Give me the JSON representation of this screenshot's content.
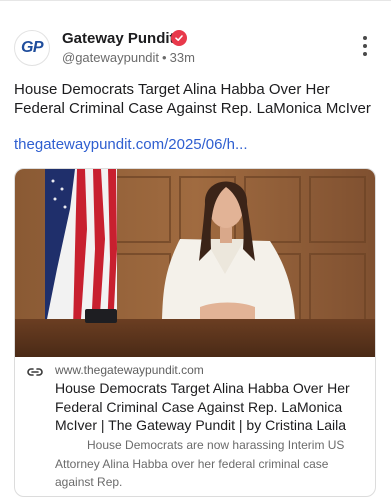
{
  "author": {
    "avatar_text": "GP",
    "name": "Gateway Pundit",
    "handle": "@gatewaypundit",
    "separator": "•",
    "time": "33m"
  },
  "post": {
    "text": "House Democrats Target Alina Habba Over Her Federal Criminal Case Against Rep. LaMonica McIver",
    "link_text": "thegatewaypundit.com/2025/06/h..."
  },
  "card": {
    "domain": "www.thegatewaypundit.com",
    "title": "House Democrats Target Alina Habba Over Her Federal Criminal Case Against Rep. LaMonica McIver | The Gateway Pundit | by Cristina Laila",
    "description": "House Democrats are now harassing Interim US Attorney Alina Habba over her federal criminal case against Rep.",
    "image_desc": "Woman in white blazer seated at desk with American flag behind, wood paneled wall"
  },
  "icons": {
    "verified": "verified-badge-icon",
    "more": "more-vertical-icon",
    "link": "link-icon"
  },
  "colors": {
    "link": "#2f5fd0",
    "verified": "#e8394b",
    "brand": "#1f4d9c"
  }
}
